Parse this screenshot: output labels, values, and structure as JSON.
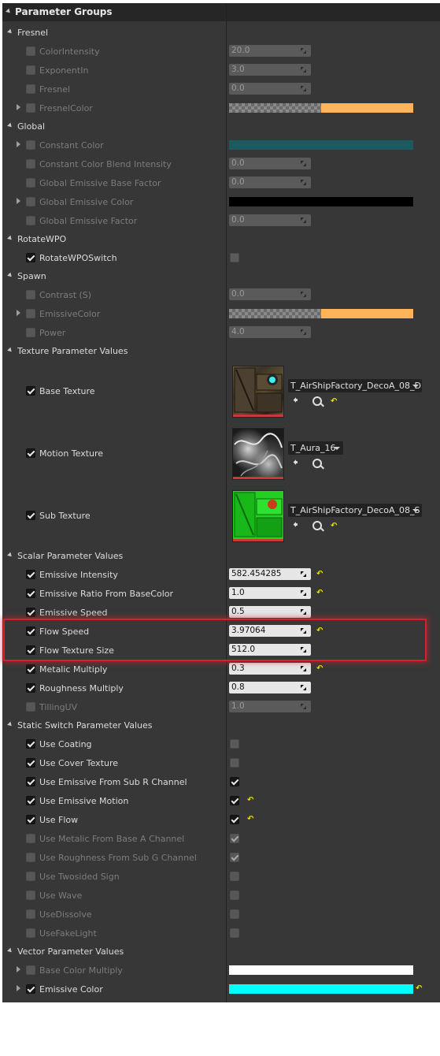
{
  "header": {
    "title": "Parameter Groups"
  },
  "fresnel": {
    "title": "Fresnel",
    "color_intensity": {
      "label": "ColorIntensity",
      "value": "20.0"
    },
    "exponent_in": {
      "label": "ExponentIn",
      "value": "3.0"
    },
    "fresnel": {
      "label": "Fresnel",
      "value": "0.0"
    },
    "fresnel_color": {
      "label": "FresnelColor",
      "color": "#ffb45a"
    }
  },
  "global": {
    "title": "Global",
    "constant_color": {
      "label": "Constant Color",
      "color": "#1d5960"
    },
    "blend_intensity": {
      "label": "Constant Color Blend Intensity",
      "value": "0.0"
    },
    "emissive_base_factor": {
      "label": "Global Emissive Base Factor",
      "value": "0.0"
    },
    "emissive_color": {
      "label": "Global Emissive Color",
      "color": "#000000"
    },
    "emissive_factor": {
      "label": "Global Emissive Factor",
      "value": "0.0"
    }
  },
  "rotate_wpo": {
    "title": "RotateWPO",
    "switch": {
      "label": "RotateWPOSwitch",
      "checked": false
    }
  },
  "spawn": {
    "title": "Spawn",
    "contrast": {
      "label": "Contrast (S)",
      "value": "0.0"
    },
    "emissive_color": {
      "label": "EmissiveColor",
      "color": "#ffb45a"
    },
    "power": {
      "label": "Power",
      "value": "4.0"
    }
  },
  "textures": {
    "title": "Texture Parameter Values",
    "base": {
      "label": "Base Texture",
      "asset": "T_AirShipFactory_DecoA_08_D"
    },
    "motion": {
      "label": "Motion Texture",
      "asset": "T_Aura_16"
    },
    "sub": {
      "label": "Sub Texture",
      "asset": "T_AirShipFactory_DecoA_08_S"
    }
  },
  "scalars": {
    "title": "Scalar Parameter Values",
    "items": [
      {
        "label": "Emissive Intensity",
        "value": "582.454285"
      },
      {
        "label": "Emissive Ratio From BaseColor",
        "value": "1.0"
      },
      {
        "label": "Emissive Speed",
        "value": "0.5"
      },
      {
        "label": "Flow Speed",
        "value": "3.97064"
      },
      {
        "label": "Flow Texture Size",
        "value": "512.0"
      },
      {
        "label": "Metalic Multiply",
        "value": "0.3"
      },
      {
        "label": "Roughness Multiply",
        "value": "0.8"
      },
      {
        "label": "TillingUV",
        "value": "1.0"
      }
    ]
  },
  "switches": {
    "title": "Static Switch Parameter Values",
    "items": [
      {
        "label": "Use Coating"
      },
      {
        "label": "Use Cover Texture"
      },
      {
        "label": "Use Emissive From Sub R Channel"
      },
      {
        "label": "Use Emissive Motion"
      },
      {
        "label": "Use Flow"
      },
      {
        "label": "Use Metalic From Base A Channel"
      },
      {
        "label": "Use Roughness From Sub G Channel"
      },
      {
        "label": "Use Twosided Sign"
      },
      {
        "label": "Use Wave"
      },
      {
        "label": "UseDissolve"
      },
      {
        "label": "UseFakeLight"
      }
    ]
  },
  "vectors": {
    "title": "Vector Parameter Values",
    "base_color_multiply": {
      "label": "Base Color Multiply",
      "color": "#ffffff"
    },
    "emissive_color": {
      "label": "Emissive Color",
      "color": "#00ffff"
    }
  },
  "icons": {
    "reset": "reset-to-default-icon",
    "browse": "browse-arrow-icon",
    "find": "search-icon",
    "grip": "drag-handle-icon"
  }
}
